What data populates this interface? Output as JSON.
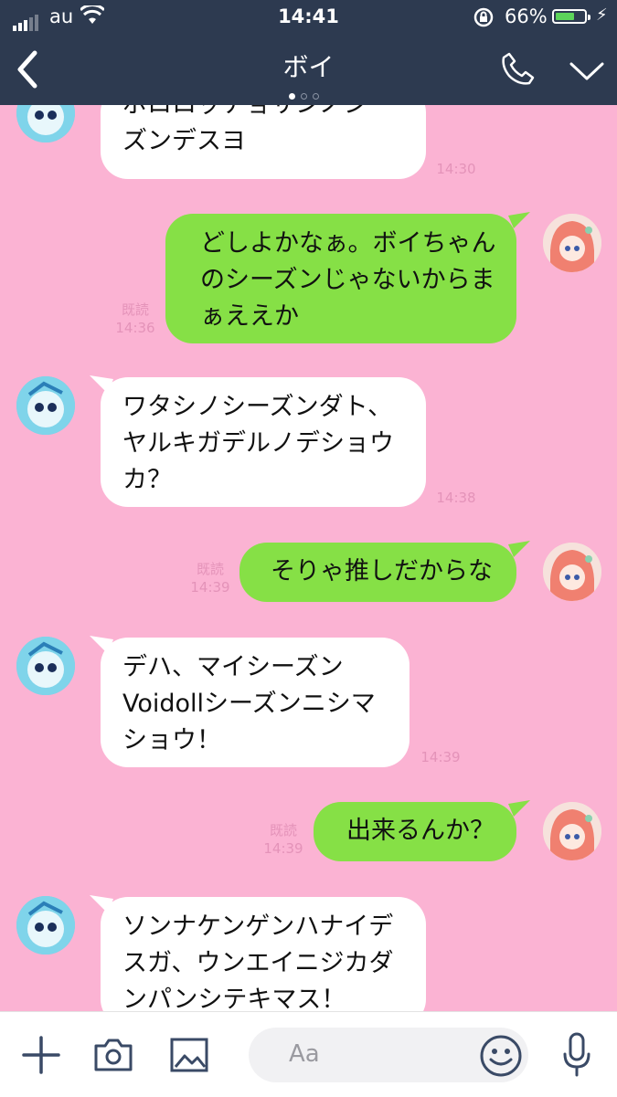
{
  "status": {
    "carrier": "au",
    "time": "14:41",
    "battery_percent": "66%",
    "battery_level": 0.66
  },
  "header": {
    "title": "ボイ",
    "page_dots": 3,
    "active_dot": 0
  },
  "messages": [
    {
      "side": "in",
      "lines": [
        "ポロロッチョサンノシー",
        "ズンデスヨ"
      ],
      "time": "14:30"
    },
    {
      "side": "out",
      "lines": [
        "どしよかなぁ。ボイちゃん",
        "のシーズンじゃないからま",
        "ぁええか"
      ],
      "read": "既読",
      "time": "14:36"
    },
    {
      "side": "in",
      "lines": [
        "ワタシノシーズンダト、",
        "ヤルキガデルノデショウ",
        "カ？"
      ],
      "time": "14:38"
    },
    {
      "side": "out",
      "lines": [
        "そりゃ推しだからな"
      ],
      "read": "既読",
      "time": "14:39"
    },
    {
      "side": "in",
      "lines": [
        "デハ、マイシーズン",
        "Voidollシーズンニシマ",
        "ショウ！"
      ],
      "time": "14:39"
    },
    {
      "side": "out",
      "lines": [
        "出来るんか？"
      ],
      "read": "既読",
      "time": "14:39"
    },
    {
      "side": "in",
      "lines": [
        "ソンナケンゲンハナイデ",
        "スガ、ウンエイニジカダ",
        "ンパンシテキマス！"
      ],
      "time": ""
    }
  ],
  "input": {
    "placeholder": "Aa"
  },
  "colors": {
    "header_bg": "#2d3a50",
    "chat_bg": "#fbb3d3",
    "outgoing_bubble": "#86e046",
    "incoming_bubble": "#ffffff",
    "meta_text": "#e493b9",
    "battery_fill": "#5cd45a"
  },
  "icons": [
    "back-icon",
    "phone-icon",
    "chevron-down-icon",
    "plus-icon",
    "camera-icon",
    "image-icon",
    "emoji-icon",
    "microphone-icon",
    "wifi-icon",
    "rotation-lock-icon",
    "battery-icon",
    "charging-icon"
  ]
}
